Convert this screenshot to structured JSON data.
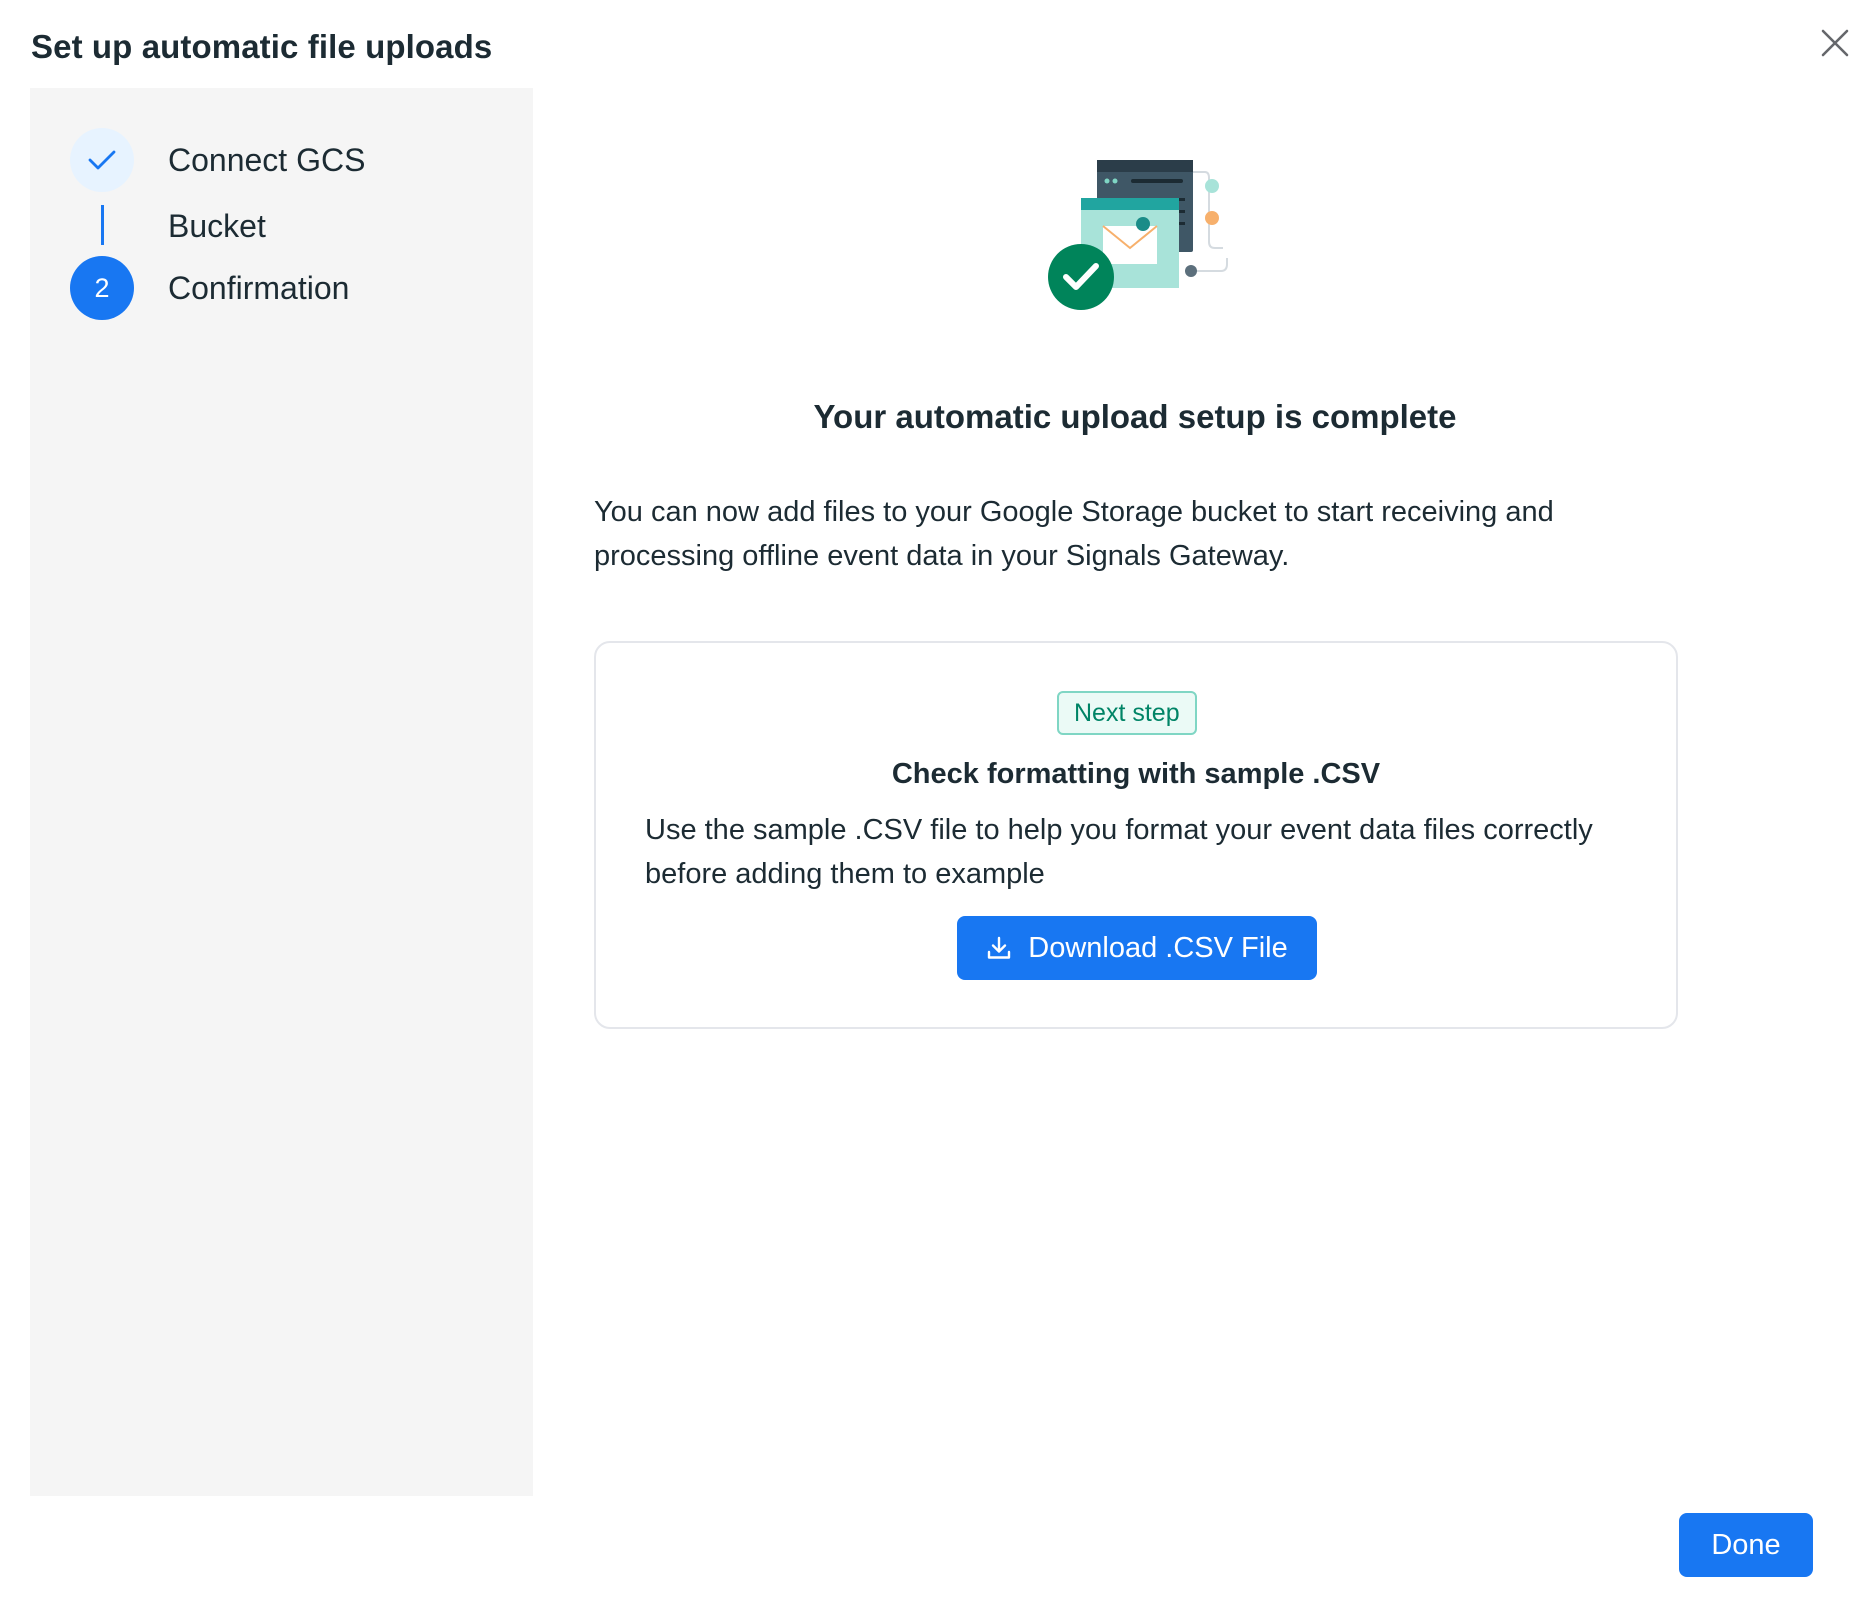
{
  "dialog": {
    "title": "Set up automatic file uploads",
    "close_icon": "close-icon"
  },
  "stepper": {
    "steps": [
      {
        "label": "Connect GCS",
        "state": "completed",
        "icon": "checkmark-icon"
      },
      {
        "label": "Bucket",
        "state": "substep"
      },
      {
        "label": "Confirmation",
        "state": "active",
        "number": "2"
      }
    ],
    "accent_color": "#1877f2"
  },
  "main": {
    "illustration": "upload-complete-illustration",
    "heading": "Your automatic upload setup is complete",
    "description": "You can now add files to your Google Storage bucket to start receiving and processing offline event data in your Signals Gateway."
  },
  "next_step_card": {
    "badge": "Next step",
    "title": "Check formatting with sample .CSV",
    "description": "Use the sample .CSV file to help you format your event data files correctly before adding them to example",
    "download_button_label": "Download .CSV File",
    "download_icon": "download-icon"
  },
  "footer": {
    "done_label": "Done"
  },
  "colors": {
    "primary": "#1877f2",
    "success": "#00845a",
    "badge_text": "#008466",
    "panel_bg": "#f5f5f5"
  }
}
